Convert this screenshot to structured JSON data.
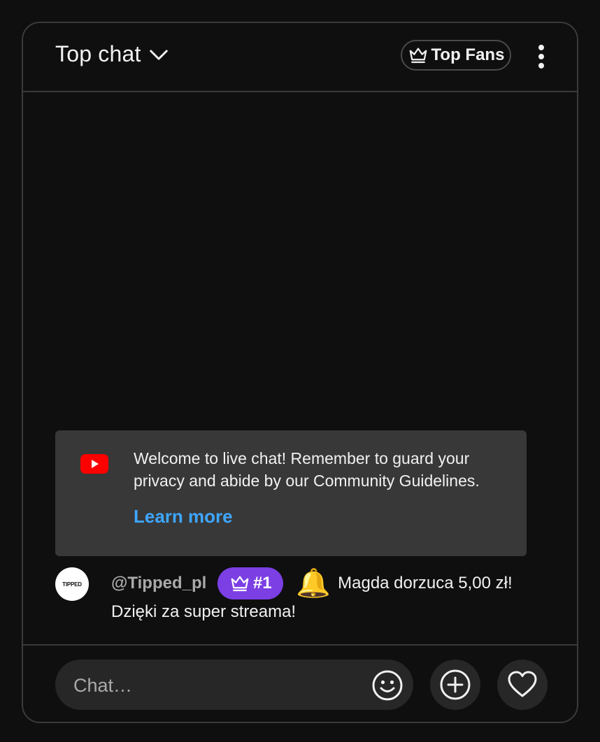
{
  "header": {
    "chat_mode_label": "Top chat",
    "top_fans_label": "Top Fans"
  },
  "welcome": {
    "text": "Welcome to live chat! Remember to guard your privacy and abide by our Community Guidelines.",
    "learn_more": "Learn more"
  },
  "message": {
    "avatar_text": "TIPPED",
    "author": "@Tipped_pl",
    "rank_badge": "#1",
    "bell": "🔔",
    "text_line1": "Magda dorzuca 5,00 zł!",
    "text_line2": "Dzięki za super streama!"
  },
  "composer": {
    "placeholder": "Chat…"
  },
  "icons": {
    "chevron": "chevron-down-icon",
    "crown": "crown-icon",
    "more": "more-vert-icon",
    "youtube": "youtube-logo-icon",
    "emoji": "emoji-icon",
    "add": "add-circle-icon",
    "heart": "heart-icon"
  },
  "colors": {
    "background": "#0f0f0f",
    "border": "#3a3a3a",
    "welcome_card": "#383838",
    "link": "#3ea6ff",
    "rank_badge": "#7b3fe4",
    "youtube_red": "#ff0000"
  }
}
